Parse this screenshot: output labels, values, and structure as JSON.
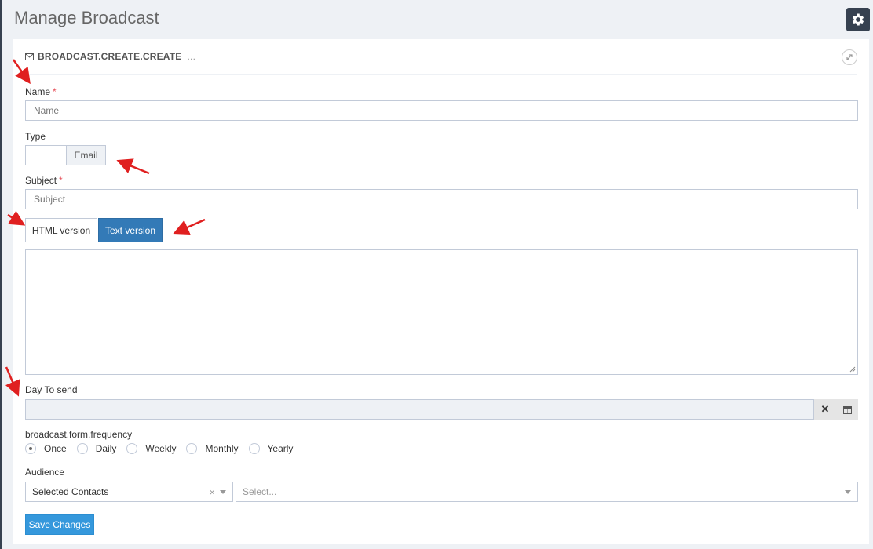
{
  "page": {
    "title": "Manage Broadcast"
  },
  "icons": {
    "settings": "gear-icon",
    "caption": "envelope-icon",
    "expand": "expand-icon",
    "clear": "times-icon",
    "calendar": "calendar-icon"
  },
  "colors": {
    "sidebar": "#364150",
    "primary": "#337ab7",
    "save": "#3598dc",
    "required": "#e7505a",
    "annotation_arrow": "#e02020"
  },
  "portlet": {
    "caption": "BROADCAST.CREATE.CREATE",
    "ellipsis": "..."
  },
  "form": {
    "name": {
      "label": "Name",
      "required_mark": "*",
      "placeholder": "Name",
      "value": ""
    },
    "type": {
      "label": "Type",
      "addon": "Email"
    },
    "subject": {
      "label": "Subject",
      "required_mark": "*",
      "placeholder": "Subject",
      "value": ""
    },
    "tabs": [
      {
        "label": "HTML version",
        "active": false
      },
      {
        "label": "Text version",
        "active": true
      }
    ],
    "day_to_send": {
      "label": "Day To send",
      "value": ""
    },
    "frequency": {
      "label": "broadcast.form.frequency",
      "options": [
        "Once",
        "Daily",
        "Weekly",
        "Monthly",
        "Yearly"
      ],
      "selected": "Once"
    },
    "audience": {
      "label": "Audience",
      "selected_value": "Selected Contacts",
      "clear_symbol": "×",
      "second_placeholder": "Select..."
    },
    "save_label": "Save Changes"
  }
}
